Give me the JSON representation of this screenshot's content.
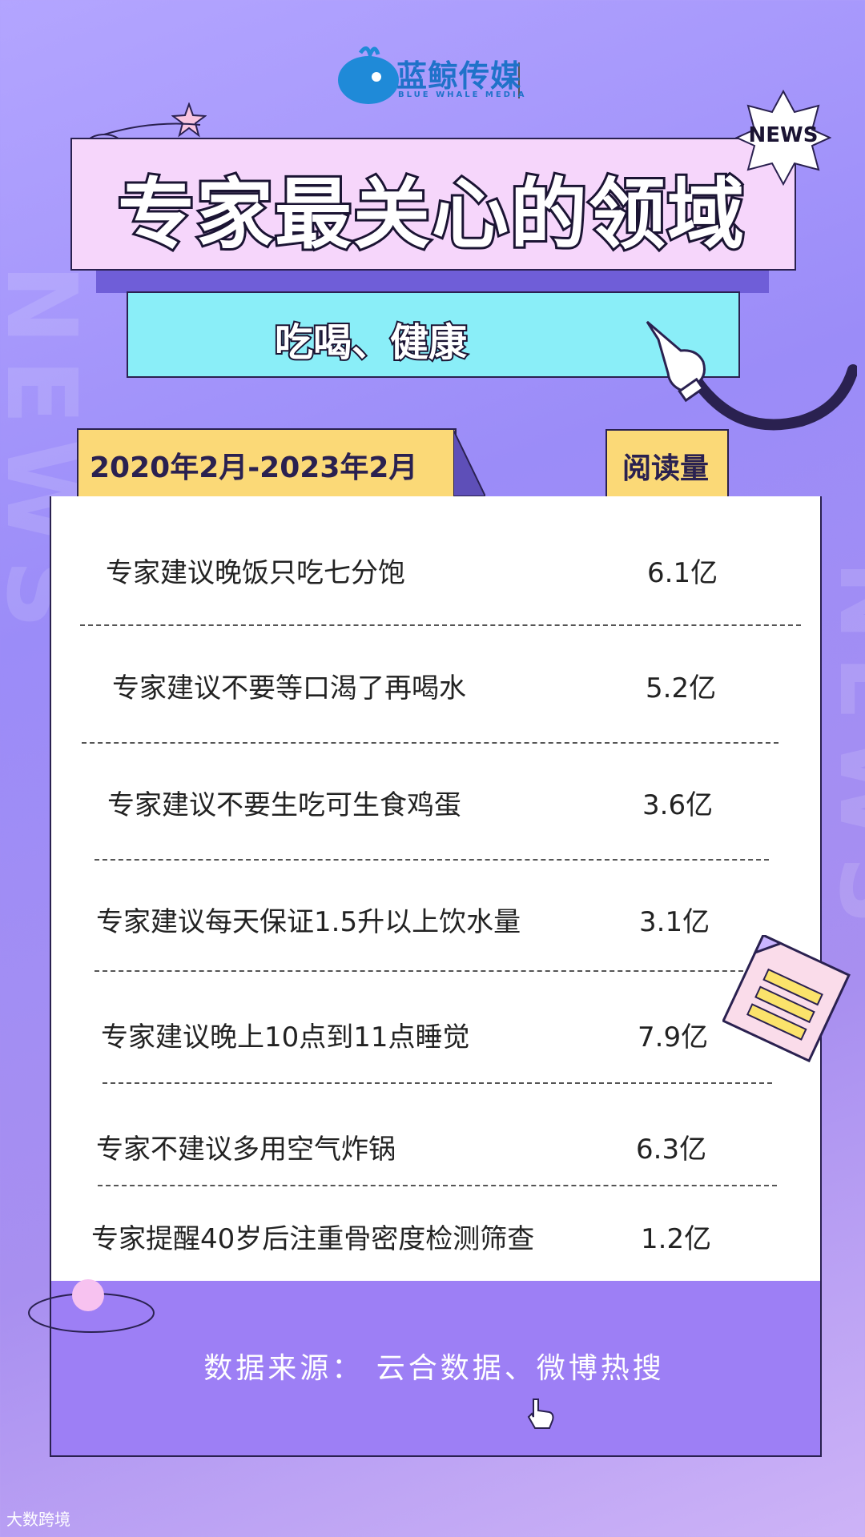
{
  "brand": {
    "name": "蓝鲸传媒",
    "tagline": "BLUE WHALE MEDIA"
  },
  "badge": "NEWS",
  "watermark": "NEWS",
  "title": "专家最关心的领域",
  "subtitle": "吃喝、健康",
  "period": "2020年2月-2023年2月",
  "metric_header": "阅读量",
  "rows": [
    {
      "label": "专家建议晚饭只吃七分饱",
      "value": "6.1亿"
    },
    {
      "label": "专家建议不要等口渴了再喝水",
      "value": "5.2亿"
    },
    {
      "label": "专家建议不要生吃可生食鸡蛋",
      "value": "3.6亿"
    },
    {
      "label": "专家建议每天保证1.5升以上饮水量",
      "value": "3.1亿"
    },
    {
      "label": "专家建议晚上10点到11点睡觉",
      "value": "7.9亿"
    },
    {
      "label": "专家不建议多用空气炸锅",
      "value": "6.3亿"
    },
    {
      "label": "专家提醒40岁后注重骨密度检测筛查",
      "value": "1.2亿"
    }
  ],
  "source": "数据来源：  云合数据、微博热搜",
  "corner_mark": "大数跨境",
  "colors": {
    "accent_pink": "#f6d6fb",
    "accent_cyan": "#8aeef8",
    "accent_yellow": "#fbd977",
    "footer_purple": "#9d7ff5"
  }
}
